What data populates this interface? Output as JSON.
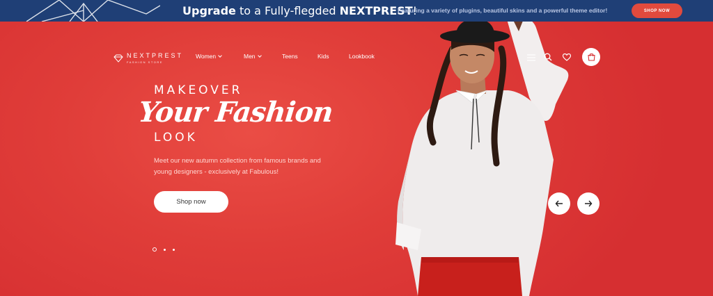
{
  "promo": {
    "prefix": "Upgrade",
    "middle": " to a Fully-flegded ",
    "brand": "NEXTPREST",
    "suffix": "!",
    "subtitle": "Featuring a variety of plugins, beautiful skins and a powerful theme editor!",
    "button": "SHOP NOW",
    "bg_color": "#1f3f76",
    "button_color": "#e14a3d"
  },
  "header": {
    "logo_main": "NEXTPREST",
    "logo_sub": "FASHION STORE",
    "nav": [
      {
        "label": "Women",
        "has_dropdown": true
      },
      {
        "label": "Men",
        "has_dropdown": true
      },
      {
        "label": "Teens",
        "has_dropdown": false
      },
      {
        "label": "Kids",
        "has_dropdown": false
      },
      {
        "label": "Lookbook",
        "has_dropdown": false
      }
    ],
    "icons": [
      "menu-icon",
      "search-icon",
      "heart-icon",
      "cart-icon"
    ]
  },
  "hero": {
    "eyebrow": "MAKEOVER",
    "headline": "Your Fashion",
    "tail": "LOOK",
    "description": "Meet our new autumn collection from famous brands and young designers - exclusively at Fabulous!",
    "cta": "Shop now",
    "bg_color": "#e03d39",
    "slides_count": 3,
    "active_slide": 1
  }
}
